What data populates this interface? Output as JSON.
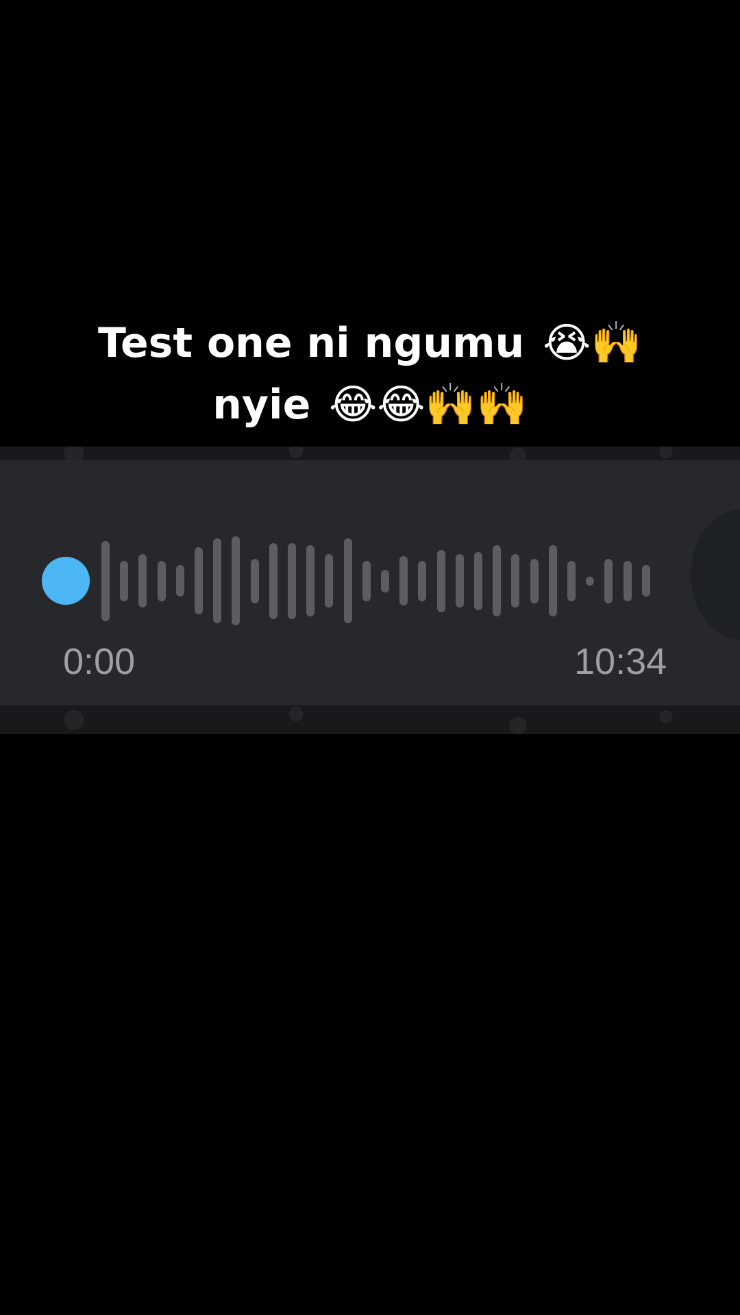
{
  "caption": {
    "line1_text": "Test one ni ngumu",
    "line1_emoji": "😭🙌",
    "line2_text": "nyie",
    "line2_emoji": "😂😂🙌🙌"
  },
  "voice_note": {
    "current_time": "0:00",
    "total_time": "10:34",
    "progress": 0.0,
    "icons": [
      "progress-knob-icon"
    ],
    "colors": {
      "accent": "#4db7f5",
      "bubble": "#26282b",
      "waveform": "#5b5d60",
      "time_text": "#9ea1a4"
    },
    "waveform_levels": [
      0.9,
      0.45,
      0.6,
      0.45,
      0.35,
      0.75,
      0.95,
      1.0,
      0.5,
      0.85,
      0.85,
      0.8,
      0.6,
      0.95,
      0.45,
      0.25,
      0.55,
      0.45,
      0.7,
      0.6,
      0.65,
      0.8,
      0.6,
      0.5,
      0.8,
      0.45,
      0.1,
      0.5,
      0.45,
      0.35
    ]
  }
}
